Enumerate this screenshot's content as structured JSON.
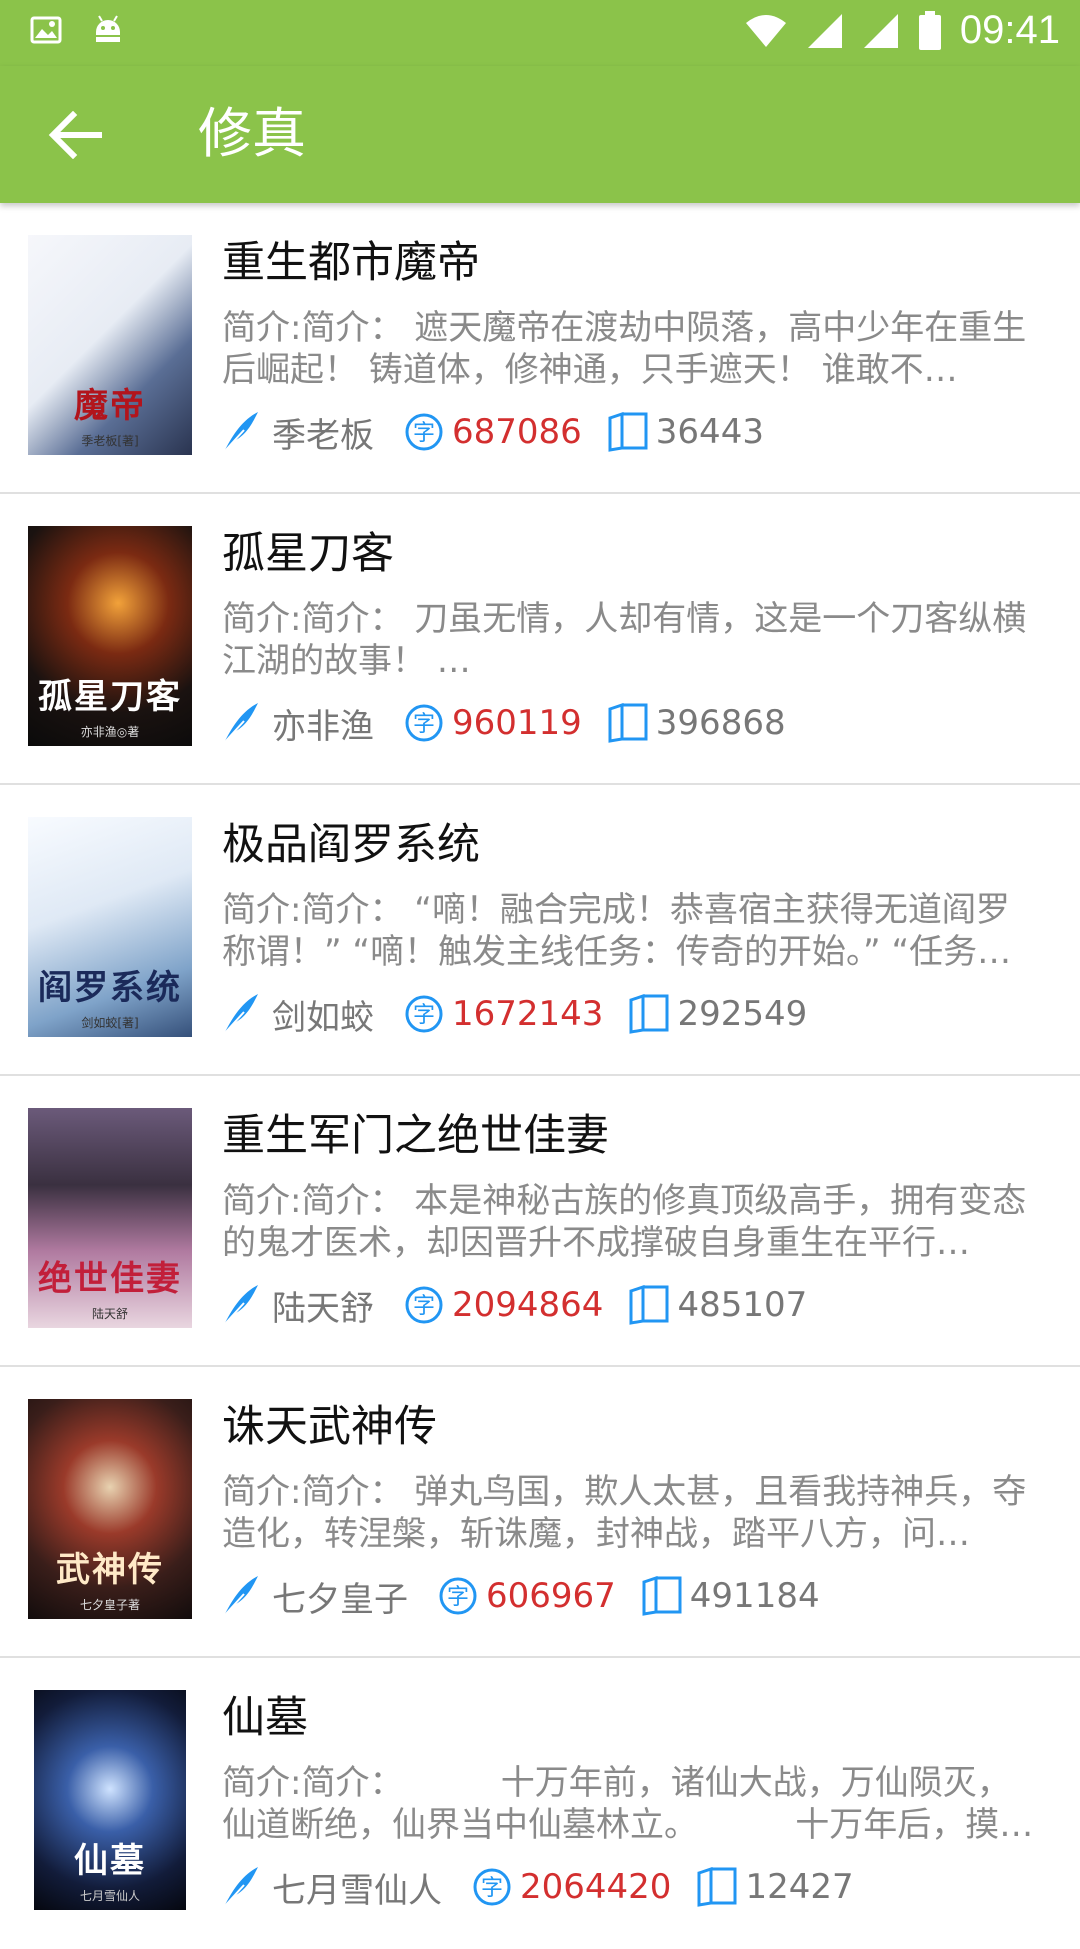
{
  "status": {
    "time": "09:41",
    "icons": [
      "image-icon",
      "android-icon",
      "wifi-icon",
      "signal-icon",
      "signal-icon",
      "battery-icon"
    ]
  },
  "app_bar": {
    "title": "修真",
    "back_icon": "arrow-left-icon"
  },
  "colors": {
    "primary": "#8bc34a",
    "accent_blue": "#2196f3",
    "word_count_red": "#d32f2f",
    "intro_gray": "#8a8a8a"
  },
  "books": [
    {
      "title": "重生都市魔帝",
      "intro": "简介:简介： 遮天魔帝在渡劫中陨落，高中少年在重生后崛起！ 铸道体，修神通，只手遮天！ 谁敢不…",
      "author": "季老板",
      "words": "687086",
      "chapters": "36443",
      "cover_text": "魔帝",
      "cover_author": "季老板[著]"
    },
    {
      "title": "孤星刀客",
      "intro": "简介:简介： 刀虽无情，人却有情，这是一个刀客纵横江湖的故事！ …",
      "author": "亦非渔",
      "words": "960119",
      "chapters": "396868",
      "cover_text": "孤星刀客",
      "cover_author": "亦非渔◎著"
    },
    {
      "title": "极品阎罗系统",
      "intro": "简介:简介： “嘀！融合完成！恭喜宿主获得无道阎罗称谓！” “嘀！触发主线任务：传奇的开始。” “任务…",
      "author": "剑如蛟",
      "words": "1672143",
      "chapters": "292549",
      "cover_text": "阎罗系统",
      "cover_author": "剑如蛟[著]"
    },
    {
      "title": "重生军门之绝世佳妻",
      "intro": "简介:简介： 本是神秘古族的修真顶级高手，拥有变态的鬼才医术，却因晋升不成撑破自身重生在平行…",
      "author": "陆天舒",
      "words": "2094864",
      "chapters": "485107",
      "cover_text": "绝世佳妻",
      "cover_author": "陆天舒"
    },
    {
      "title": "诛天武神传",
      "intro": "简介:简介： 弹丸鸟国，欺人太甚，且看我持神兵，夺造化，转涅槃，斩诛魔，封神战，踏平八方，问…",
      "author": "七夕皇子",
      "words": "606967",
      "chapters": "491184",
      "cover_text": "武神传",
      "cover_author": "七夕皇子著"
    },
    {
      "title": "仙墓",
      "intro": "简介:简介：         十万年前，诸仙大战，万仙陨灭，仙道断绝，仙界当中仙墓林立。         十万年后，摸…",
      "author": "七月雪仙人",
      "words": "2064420",
      "chapters": "12427",
      "cover_text": "仙墓",
      "cover_author": "七月雪仙人"
    }
  ]
}
